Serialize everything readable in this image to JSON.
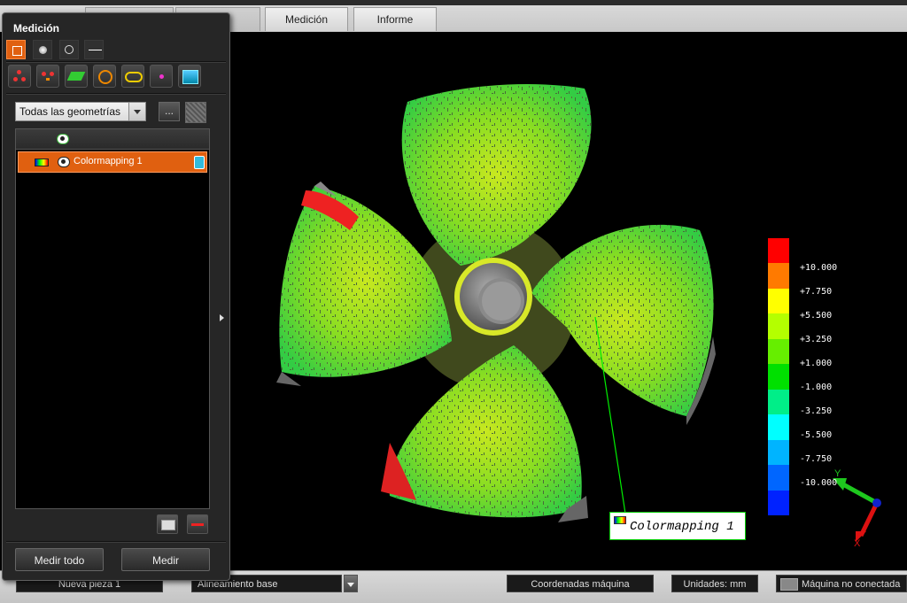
{
  "tabs": [
    {
      "label": "Medición",
      "active": true
    },
    {
      "label": "Informe",
      "active": false
    }
  ],
  "panel": {
    "title": "Medición",
    "toolbar_top": [
      {
        "icon": "cube-icon",
        "active": true
      },
      {
        "icon": "sphere-icon",
        "active": false
      },
      {
        "icon": "shapes-icon",
        "active": false
      },
      {
        "icon": "distance-icon",
        "active": false
      }
    ],
    "toolbar_features": [
      {
        "icon": "points-icon"
      },
      {
        "icon": "point-pair-icon"
      },
      {
        "icon": "plane-icon"
      },
      {
        "icon": "circle-icon"
      },
      {
        "icon": "slot-icon"
      },
      {
        "icon": "single-point-icon"
      },
      {
        "icon": "surface-icon"
      }
    ],
    "filter_select": {
      "value": "Todas las geometrías"
    },
    "more_button": "...",
    "list": {
      "items": [
        {
          "label": "Colormapping 1",
          "visible": true
        }
      ]
    },
    "buttons": {
      "measure_all": "Medir todo",
      "measure": "Medir"
    }
  },
  "legend": {
    "ticks": [
      "+10.000",
      "+7.750",
      "+5.500",
      "+3.250",
      "+1.000",
      "-1.000",
      "-3.250",
      "-5.500",
      "-7.750",
      "-10.000"
    ],
    "colors": [
      "#ff0000",
      "#ff7a00",
      "#ffff00",
      "#b4ff00",
      "#66ee00",
      "#00e000",
      "#00ee88",
      "#00ffff",
      "#00b4ff",
      "#0066ff",
      "#0022ff"
    ]
  },
  "callout": {
    "label": "Colormapping 1"
  },
  "axes": {
    "x": "X",
    "y": "Y"
  },
  "status": {
    "part": "Nueva pieza 1",
    "alignment": "Alineamiento base",
    "coords": "Coordenadas máquina",
    "units": "Unidades: mm",
    "machine": "Máquina no conectada"
  },
  "colors": {
    "accent": "#e06010",
    "panel_bg": "#262626"
  }
}
